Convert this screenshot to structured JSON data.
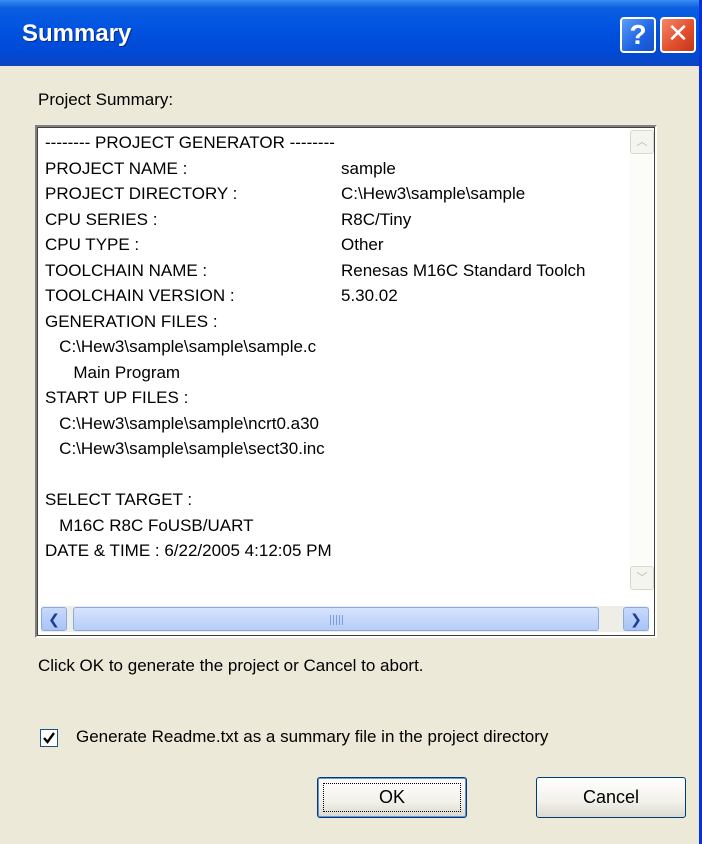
{
  "window": {
    "title": "Summary"
  },
  "titlebar": {
    "help_label": "?",
    "close_label": "✕"
  },
  "project_summary_label": "Project Summary:",
  "summary": {
    "lines": [
      {
        "label": "-------- PROJECT GENERATOR --------",
        "value": ""
      },
      {
        "label": "PROJECT NAME :",
        "value": "sample"
      },
      {
        "label": "PROJECT DIRECTORY :",
        "value": "C:\\Hew3\\sample\\sample"
      },
      {
        "label": "CPU SERIES :",
        "value": "R8C/Tiny"
      },
      {
        "label": "CPU TYPE :",
        "value": "Other"
      },
      {
        "label": "TOOLCHAIN NAME :",
        "value": "Renesas M16C Standard Toolch"
      },
      {
        "label": "TOOLCHAIN VERSION :",
        "value": "5.30.02"
      },
      {
        "label": "GENERATION FILES :",
        "value": ""
      },
      {
        "label": "   C:\\Hew3\\sample\\sample\\sample.c",
        "value": ""
      },
      {
        "label": "      Main Program",
        "value": ""
      },
      {
        "label": "START UP FILES :",
        "value": ""
      },
      {
        "label": "   C:\\Hew3\\sample\\sample\\ncrt0.a30",
        "value": ""
      },
      {
        "label": "   C:\\Hew3\\sample\\sample\\sect30.inc",
        "value": ""
      },
      {
        "label": "",
        "value": ""
      },
      {
        "label": "SELECT TARGET :",
        "value": ""
      },
      {
        "label": "   M16C R8C FoUSB/UART",
        "value": ""
      },
      {
        "label": "DATE & TIME : 6/22/2005 4:12:05 PM",
        "value": ""
      }
    ]
  },
  "instruction_text": "Click OK to generate the project or Cancel to abort.",
  "readme_checkbox": {
    "label": "Generate Readme.txt as a summary file in the project directory",
    "checked": true
  },
  "buttons": {
    "ok": "OK",
    "cancel": "Cancel"
  },
  "scrollbar_icons": {
    "up": "chevron-up-icon",
    "down": "chevron-down-icon",
    "left": "arrow-left-icon",
    "right": "arrow-right-icon"
  }
}
